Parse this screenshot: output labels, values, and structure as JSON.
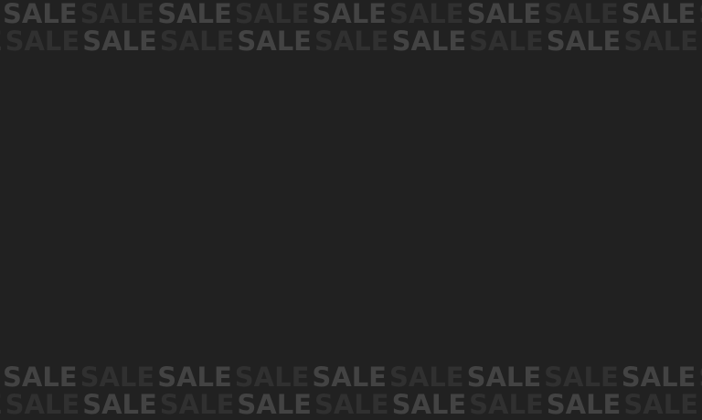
{
  "banner": {
    "word": "SALE",
    "colors": {
      "background": "#212121",
      "word_light": "#434343",
      "word_dark": "#303030"
    }
  }
}
